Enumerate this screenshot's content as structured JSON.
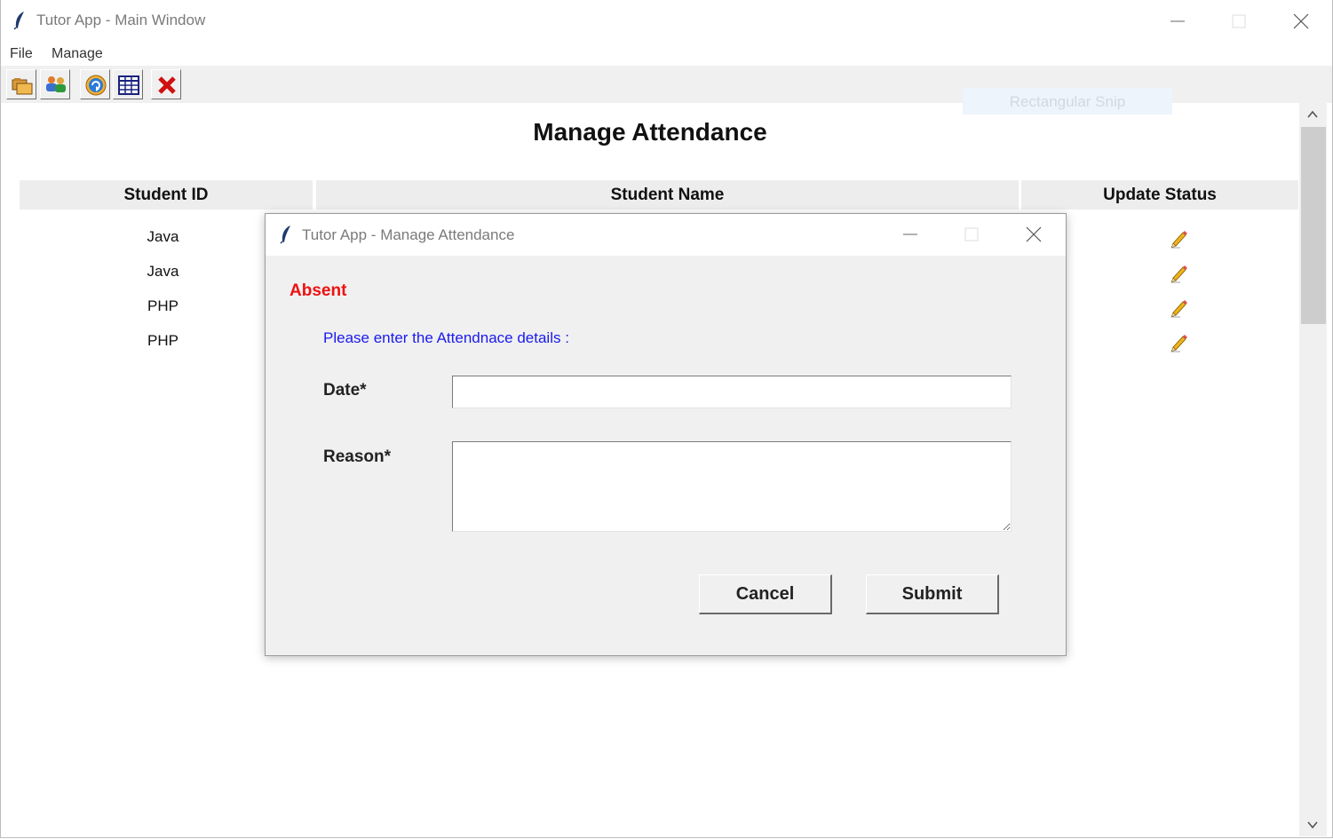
{
  "main_window": {
    "title": "Tutor App - Main Window"
  },
  "menu": {
    "items": [
      "File",
      "Manage"
    ]
  },
  "toolbar": {
    "icons": [
      "folder-icon",
      "users-icon",
      "refresh-icon",
      "table-icon",
      "close-red-icon"
    ]
  },
  "snip_tooltip": "Rectangular Snip",
  "page": {
    "title": "Manage Attendance"
  },
  "table": {
    "columns": [
      "Student ID",
      "Student Name",
      "Update Status"
    ],
    "rows": [
      {
        "id": "Java"
      },
      {
        "id": "Java"
      },
      {
        "id": "PHP"
      },
      {
        "id": "PHP"
      }
    ],
    "edit_icon": "pencil-icon"
  },
  "dialog": {
    "title": "Tutor App - Manage Attendance",
    "status_label": "Absent",
    "prompt": "Please enter the Attendnace details :",
    "date_label": "Date*",
    "date_value": "",
    "reason_label": "Reason*",
    "reason_value": "",
    "cancel_label": "Cancel",
    "submit_label": "Submit"
  },
  "colors": {
    "absent": "#ee1111",
    "prompt": "#1a1aee",
    "header_bg": "#ededed",
    "dialog_bg": "#f0f0f0"
  }
}
